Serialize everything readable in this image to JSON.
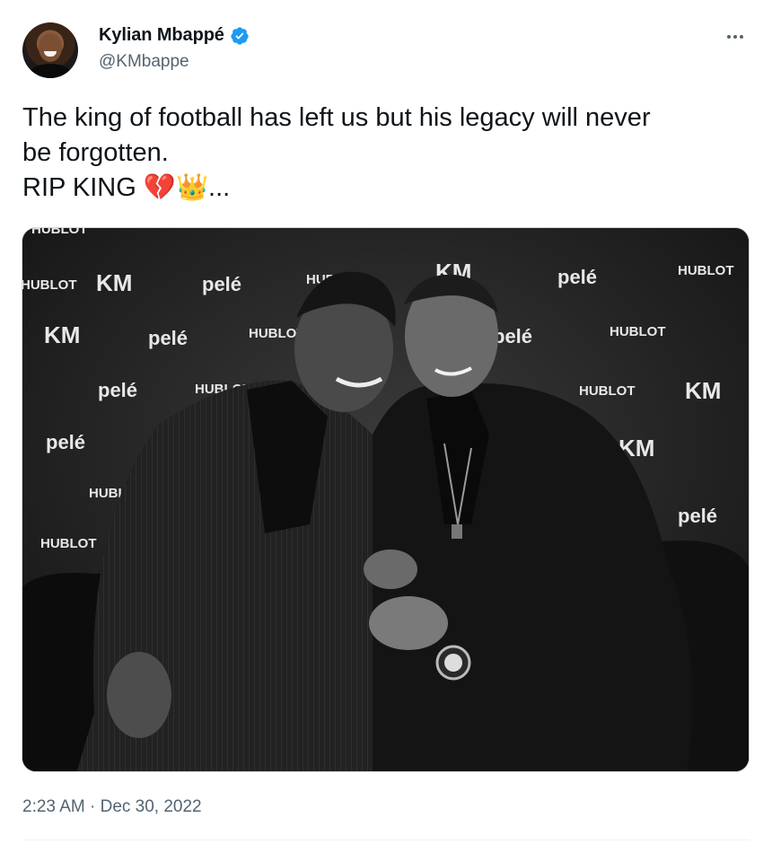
{
  "author": {
    "name": "Kylian Mbappé",
    "handle": "@KMbappe",
    "verified_icon": "verified-badge-icon",
    "avatar_icon": "avatar-photo"
  },
  "more_icon": "more-options-icon",
  "tweet": {
    "text": "The king of football has left us but his legacy will never\nbe forgotten.\nRIP KING 💔👑..."
  },
  "photo": {
    "backdrop_words": [
      "HUBLOT",
      "KM",
      "pelé"
    ]
  },
  "meta": {
    "timestamp": "2:23 AM · Dec 30, 2022"
  },
  "colors": {
    "verified": "#1d9bf0",
    "secondary_text": "#536471",
    "primary_text": "#0f1419"
  }
}
